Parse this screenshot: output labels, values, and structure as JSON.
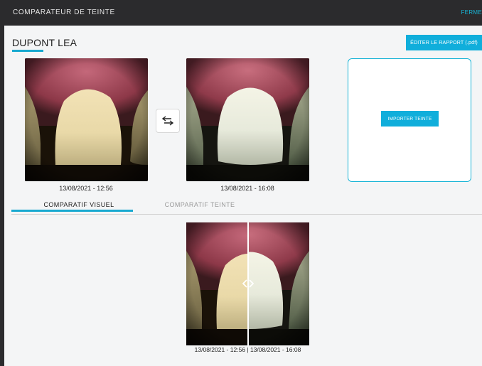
{
  "window": {
    "title": "COMPARATEUR DE TEINTE",
    "close_label": "FERME"
  },
  "patient": {
    "name": "DUPONT LEA"
  },
  "actions": {
    "report_button": "ÉDITER LE RAPPORT (.pdf)",
    "import_shade_button": "IMPORTER TEINTE"
  },
  "photos": [
    {
      "date": "13/08/2021 - 12:56"
    },
    {
      "date": "13/08/2021 - 16:08"
    }
  ],
  "tabs": [
    {
      "label": "COMPARATIF VISUEL",
      "active": true
    },
    {
      "label": "COMPARATIF TEINTE",
      "active": false
    }
  ],
  "comparison": {
    "caption": "13/08/2021 - 12:56 | 13/08/2021 - 16:08"
  },
  "colors": {
    "accent": "#10aedb",
    "titlebar": "#2b2b2d"
  },
  "icons": {
    "swap": "swap-arrows-icon",
    "compare_handle": "compare-slider-handle-icon"
  }
}
